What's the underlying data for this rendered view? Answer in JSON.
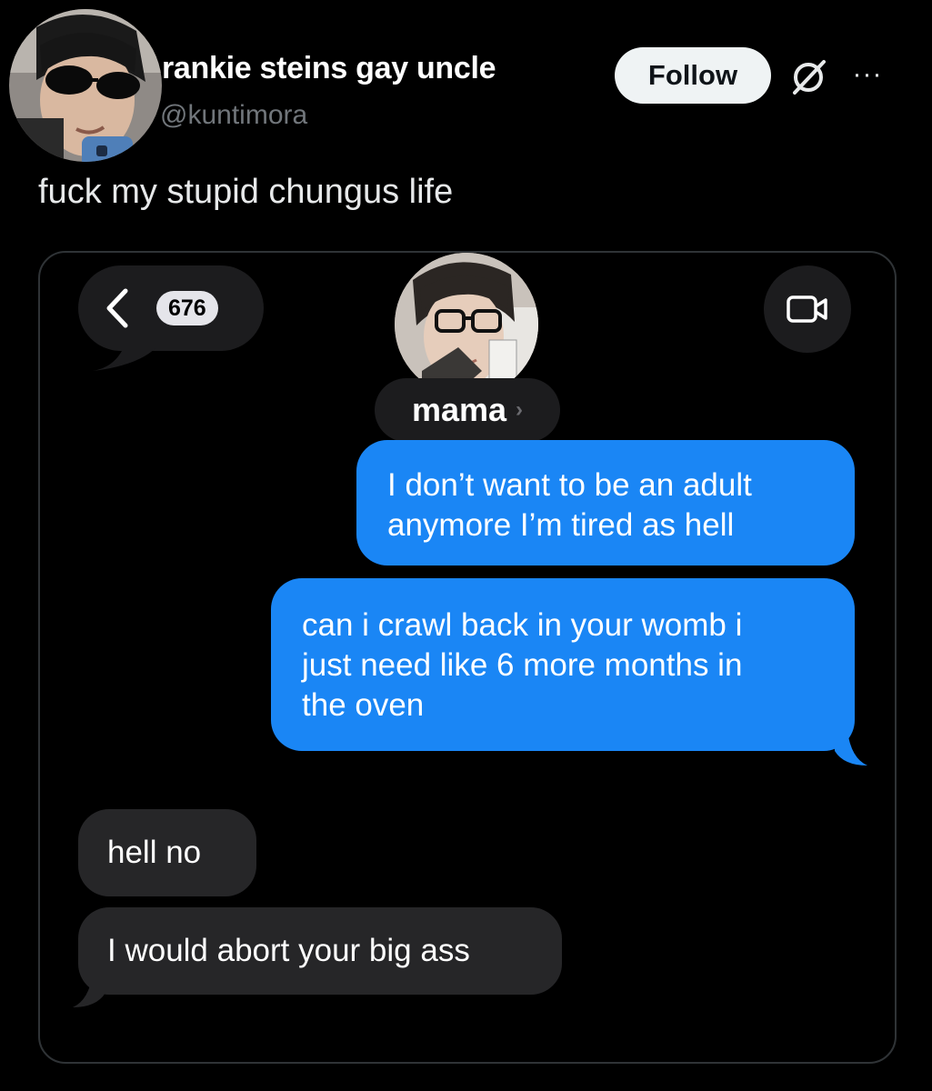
{
  "tweet": {
    "author": {
      "display_name": "rankie steins gay uncle",
      "handle": "@kuntimora"
    },
    "follow_label": "Follow",
    "more_label": "···",
    "text": "fuck my stupid chungus life"
  },
  "messages_screenshot": {
    "unread_count": "676",
    "contact_name": "mama",
    "contact_chevron": "›",
    "messages": [
      {
        "direction": "sent",
        "lines": [
          "I don’t want to be an adult",
          "anymore I’m tired as hell"
        ]
      },
      {
        "direction": "sent",
        "lines": [
          "can i crawl back in your womb i",
          "just need like 6 more months in",
          "the oven"
        ]
      },
      {
        "direction": "received",
        "lines": [
          "hell no"
        ]
      },
      {
        "direction": "received",
        "lines": [
          "I would abort your big ass"
        ]
      }
    ]
  },
  "icons": {
    "back": "chevron-left-icon",
    "video": "video-camera-icon",
    "grok": "grok-icon",
    "more": "more-icon"
  },
  "colors": {
    "background": "#000000",
    "sent_bubble": "#1a86f5",
    "received_bubble": "#262628",
    "follow_button": "#eff3f4",
    "secondary_text": "#71767b"
  }
}
